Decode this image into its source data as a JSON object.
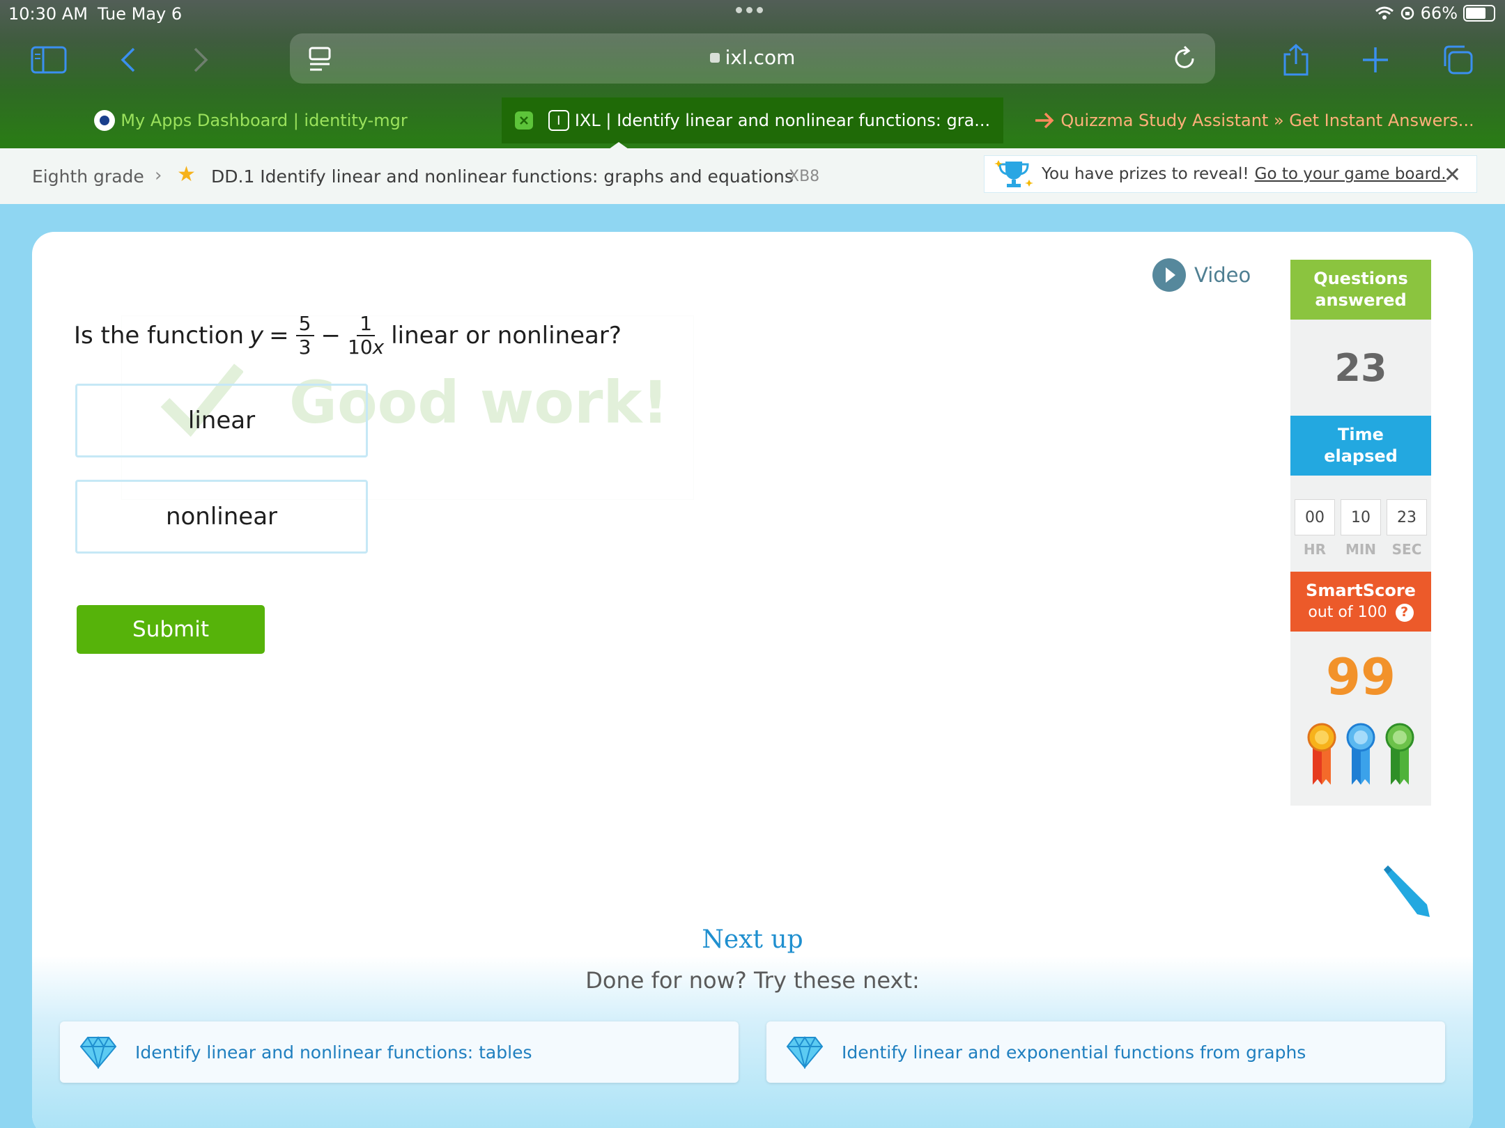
{
  "status_bar": {
    "time": "10:30 AM",
    "date": "Tue May 6",
    "battery": "66%"
  },
  "browser": {
    "url": "ixl.com",
    "tabs": [
      {
        "label": "My Apps Dashboard | identity-mgr"
      },
      {
        "label": "IXL | Identify linear and nonlinear functions: gra..."
      },
      {
        "label": "Quizzma Study Assistant » Get Instant Answers..."
      }
    ]
  },
  "breadcrumb": {
    "grade": "Eighth grade",
    "skill": "DD.1 Identify linear and nonlinear functions: graphs and equations",
    "code": "XB8"
  },
  "prize_banner": {
    "text": "You have prizes to reveal!",
    "link": "Go to your game board."
  },
  "question": {
    "prefix": "Is the function",
    "var": "y",
    "equals": "=",
    "frac1_num": "5",
    "frac1_den": "3",
    "minus": "−",
    "frac2_num": "1",
    "frac2_den_coef": "10",
    "frac2_den_var": "x",
    "suffix": "linear or nonlinear?"
  },
  "feedback": {
    "text": "Good work!"
  },
  "choices": {
    "linear": "linear",
    "nonlinear": "nonlinear"
  },
  "submit_label": "Submit",
  "video_label": "Video",
  "stats": {
    "questions_label": "Questions answered",
    "questions_count": "23",
    "time_label": "Time elapsed",
    "time_hr": "00",
    "time_min": "10",
    "time_sec": "23",
    "hr_label": "HR",
    "min_label": "MIN",
    "sec_label": "SEC",
    "smartscore_label": "SmartScore",
    "smartscore_sub": "out of 100",
    "help": "?",
    "smartscore": "99"
  },
  "next_up": {
    "title": "Next up",
    "subtitle": "Done for now? Try these next:",
    "items": [
      {
        "label": "Identify linear and nonlinear functions: tables"
      },
      {
        "label": "Identify linear and exponential functions from graphs"
      }
    ]
  },
  "colors": {
    "accent_green": "#56b30a",
    "questions_green": "#8bc43f",
    "time_blue": "#23a8e0",
    "smartscore_orange": "#ec5a2a",
    "score_orange": "#f2922a",
    "link_blue": "#1f8fcf"
  }
}
